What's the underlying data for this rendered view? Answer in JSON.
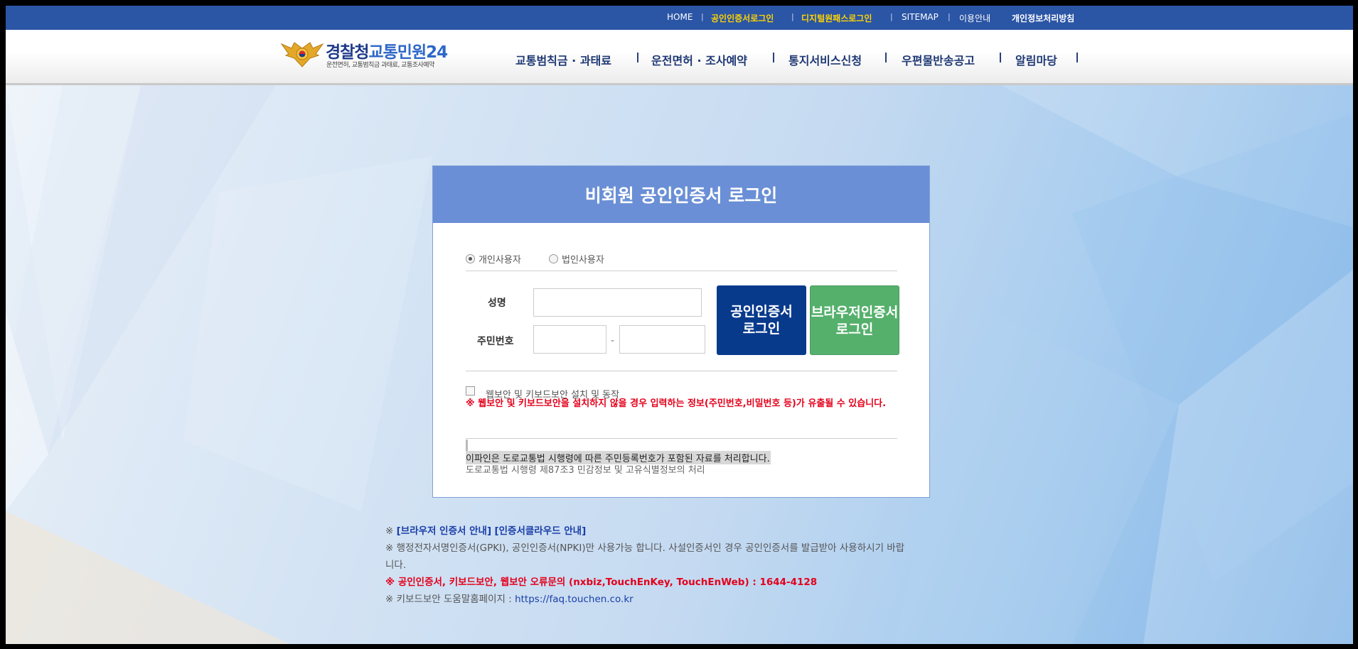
{
  "topbar": {
    "home": "HOME",
    "cert_login": "공인인증서로그인",
    "digital_pass_login": "디지털원패스로그인",
    "sitemap": "SITEMAP",
    "usage_guide": "이용안내",
    "privacy_policy": "개인정보처리방침",
    "separator": "|"
  },
  "header": {
    "logo_title_main": "경찰청",
    "logo_title_accent": "교통민원24",
    "logo_subtitle": "운전면허, 교통범칙금 과태료, 교통조사예약",
    "nav": [
      {
        "label": "교통범칙금 · 과태료"
      },
      {
        "label": "운전면허 · 조사예약"
      },
      {
        "label": "통지서비스신청"
      },
      {
        "label": "우편물반송공고"
      },
      {
        "label": "알림마당"
      }
    ]
  },
  "login": {
    "title": "비회원 공인인증서 로그인",
    "radio_personal": "개인사용자",
    "radio_corporate": "법인사용자",
    "name_label": "성명",
    "ssn_label": "주민번호",
    "ssn_separator": "-",
    "name_value": "",
    "ssn_front_value": "",
    "ssn_back_value": "",
    "cert_button_line1": "공인인증서",
    "cert_button_line2": "로그인",
    "browser_button_line1": "브라우저인증서",
    "browser_button_line2": "로그인",
    "security_checkbox_label": "웹보안 및 키보드보안 설치 및 동작",
    "security_checked": false,
    "security_warning": "※ 웹보안 및 키보드보안을 설치하지 않을 경우 입력하는 정보(주민번호,비밀번호 등)가 유출될 수 있습니다.",
    "notice_highlight": "이파인은 도로교통법 시행령에 따른 주민등록번호가 포함된 자료를 처리합니다.",
    "notice_sub": "도로교통법 시행령 제87조3 민감정보 및 고유식별정보의 처리"
  },
  "footer_notes": {
    "mark": "※",
    "browser_cert_guide": "[브라우저 인증서 안내]",
    "cert_cloud_guide": "[인증서클라우드 안내]",
    "usable_certs_line1": "※ 행정전자서명인증서(GPKI), 공인인증서(NPKI)만 사용가능 합니다. 사설인증서인 경우 공인인증서를 발급받아 사용하시기 바랍",
    "usable_certs_line2": "니다.",
    "error_inquiry": "※ 공인인증서, 키보드보안, 웹보안 오류문의 (nxbiz,TouchEnKey, TouchEnWeb) : 1644-4128",
    "keyboard_help_prefix": "※ 키보드보안 도움말홈페이지 : ",
    "keyboard_help_url": "https://faq.touchen.co.kr"
  },
  "colors": {
    "topbar": "#2b55a5",
    "highlight_yellow": "#ffd400",
    "login_header": "#6a8fd6",
    "cert_button": "#083a8c",
    "browser_button": "#55b06c",
    "warning_red": "#e3001b"
  }
}
